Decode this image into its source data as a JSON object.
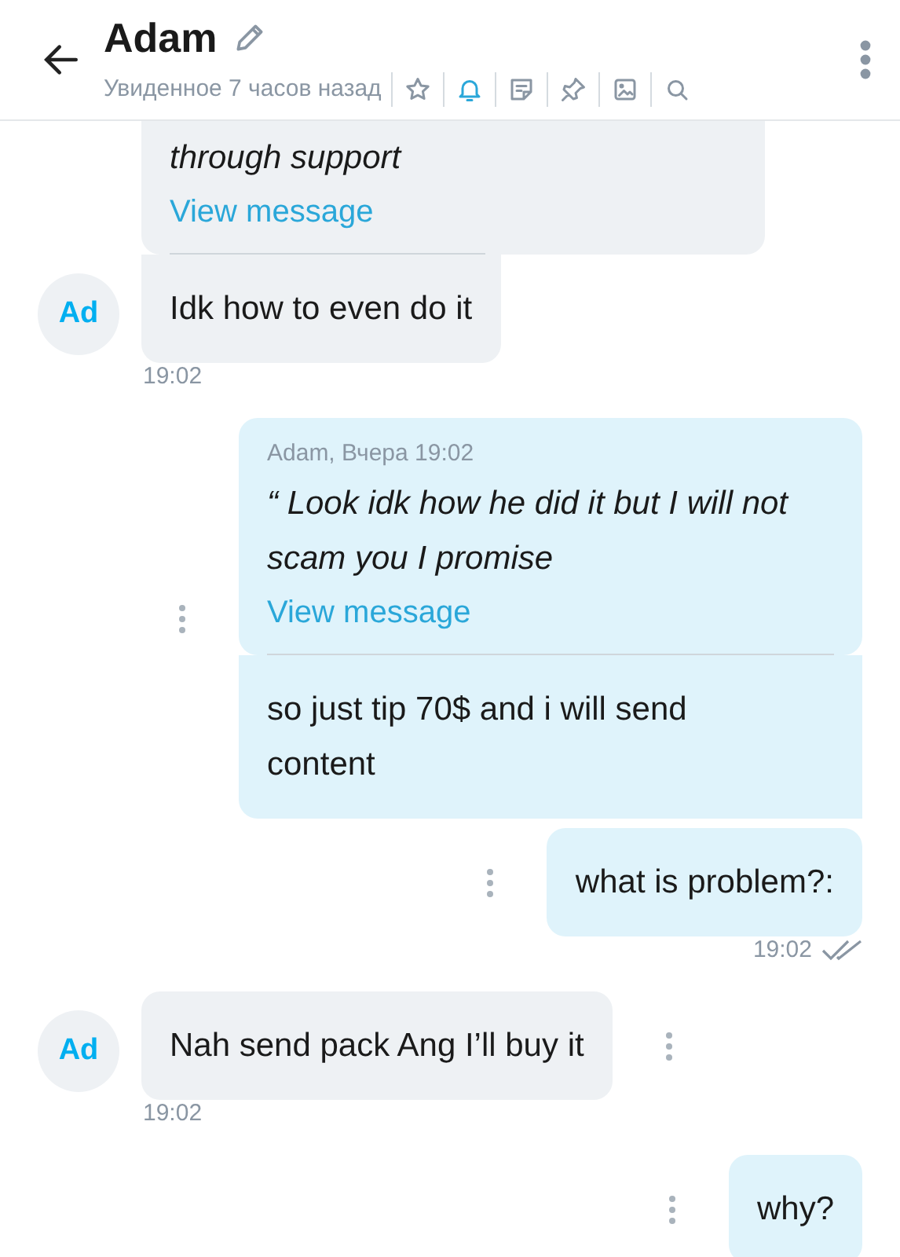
{
  "header": {
    "name": "Adam",
    "status": "Увиденное 7 часов назад",
    "notifications_on": true
  },
  "messages": [
    {
      "kind": "incoming",
      "avatar": "Ad",
      "quote_text": "through support",
      "quote_link": "View message",
      "text": "Idk how to even do it",
      "time": "19:02"
    },
    {
      "kind": "outgoing",
      "quote_author": "Adam, Вчера 19:02",
      "quote_text": "“ Look idk how he did it but I will not scam you I promise",
      "quote_link": "View message",
      "text": "so just tip 70$ and i will send content"
    },
    {
      "kind": "outgoing",
      "text": "what is problem?:",
      "time": "19:02",
      "read": true
    },
    {
      "kind": "incoming",
      "avatar": "Ad",
      "text": "Nah send pack Ang I’ll buy it",
      "time": "19:02"
    },
    {
      "kind": "outgoing",
      "text": "why?"
    }
  ]
}
